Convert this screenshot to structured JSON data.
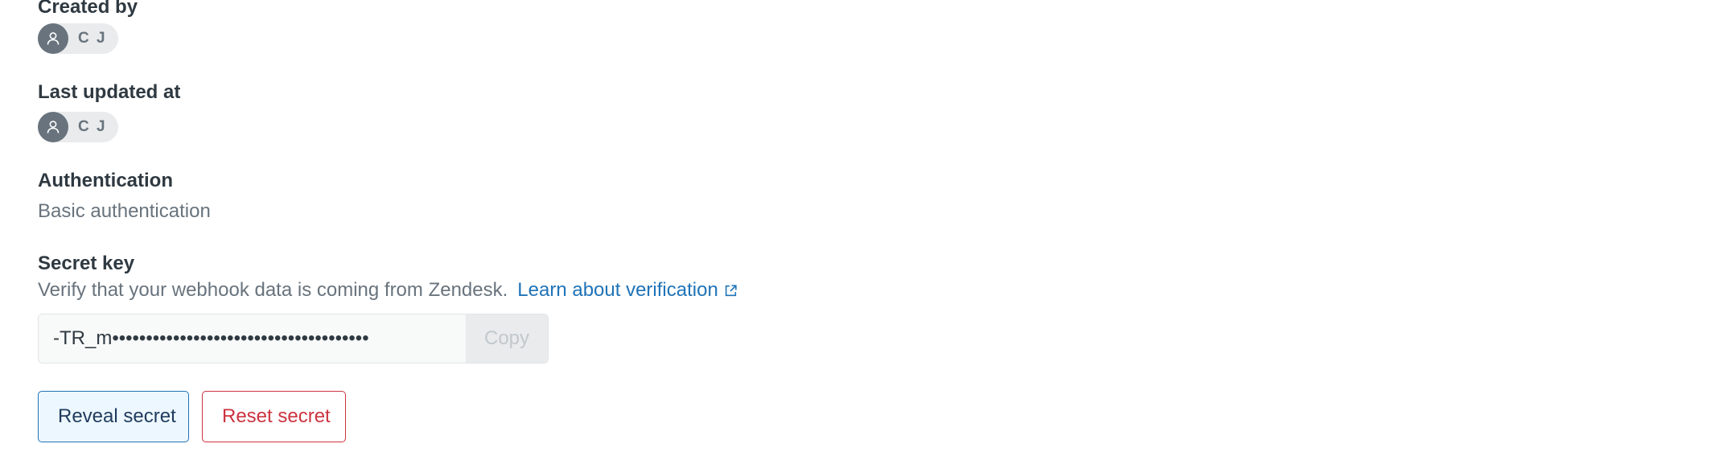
{
  "created_by": {
    "label": "Created by",
    "user_initials": "C J",
    "avatar_icon": "person-icon"
  },
  "last_updated_at": {
    "label": "Last updated at",
    "user_initials": "C J",
    "avatar_icon": "person-icon"
  },
  "authentication": {
    "label": "Authentication",
    "value": "Basic authentication"
  },
  "secret_key": {
    "label": "Secret key",
    "description": "Verify that your webhook data is coming from Zendesk.",
    "link_text": "Learn about verification",
    "link_icon": "external-link-icon",
    "masked_value": "-TR_m••••••••••••••••••••••••••••••••••••••",
    "copy_label": "Copy"
  },
  "actions": {
    "reveal_label": "Reveal secret",
    "reset_label": "Reset secret"
  },
  "colors": {
    "link": "#1f73b7",
    "danger": "#cc3340",
    "avatar_bg": "#68737d",
    "chip_bg": "#e9ebed"
  }
}
